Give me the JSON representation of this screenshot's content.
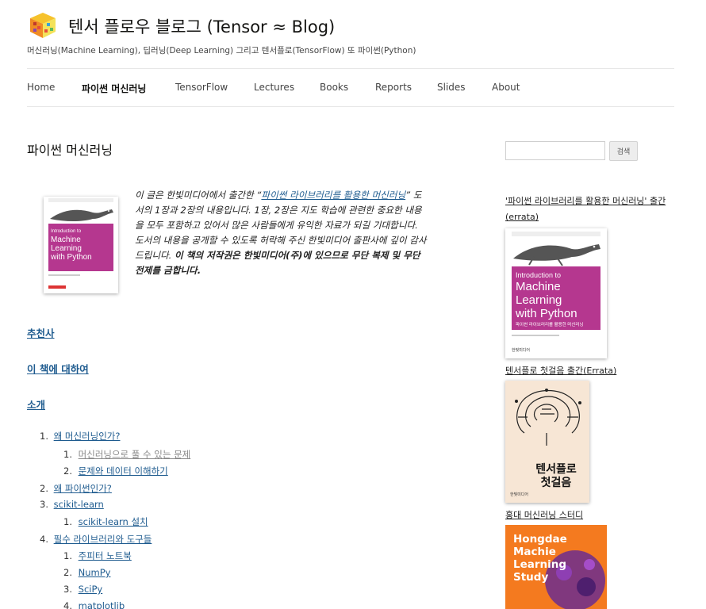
{
  "site": {
    "title": "텐서 플로우 블로그 (Tensor ≈ Blog)",
    "description": "머신러닝(Machine Learning), 딥러닝(Deep Learning) 그리고 텐서플로(TensorFlow) 또 파이썬(Python)"
  },
  "nav": [
    "Home",
    "파이썬 머신러닝",
    "TensorFlow",
    "Lectures",
    "Books",
    "Reports",
    "Slides",
    "About"
  ],
  "nav_current": "파이썬 머신러닝",
  "page": {
    "title": "파이썬 머신러닝",
    "intro_1": "이 글은 한빛미디어에서 출간한 “",
    "intro_link": "파이썬 라이브러리를 활용한 머신러닝",
    "intro_2": "” 도서의 1장과 2장의 내용입니다. 1장, 2장은 지도 학습에 관련한 중요한 내용을 모두 포함하고 있어서 많은 사람들에게 유익한 자료가 되길 기대합니다. 도서의 내용을 공개할 수 있도록 허락해 주신 한빛미디어 출판사에 깊이 감사드립니다. ",
    "intro_bold": "이 책의 저작권은 한빛미디어(주)에 있으므로 무단 복제 및 무단 전제를 금합니다."
  },
  "sections": [
    "추천사",
    "이 책에 대하여",
    "소개"
  ],
  "toc": [
    {
      "num": "1.",
      "label": "왜 머신러닝인가?",
      "children": [
        {
          "num": "1.",
          "label": "머신러닝으로 풀 수 있는 문제",
          "visited": true
        },
        {
          "num": "2.",
          "label": "문제와 데이터 이해하기"
        }
      ]
    },
    {
      "num": "2.",
      "label": "왜 파이썬인가?"
    },
    {
      "num": "3.",
      "label": "scikit-learn",
      "children": [
        {
          "num": "1.",
          "label": "scikit-learn 설치"
        }
      ]
    },
    {
      "num": "4.",
      "label": "필수 라이브러리와 도구들",
      "children": [
        {
          "num": "1.",
          "label": "주피터 노트북"
        },
        {
          "num": "2.",
          "label": "NumPy"
        },
        {
          "num": "3.",
          "label": "SciPy"
        },
        {
          "num": "4.",
          "label": "matplotlib"
        }
      ]
    }
  ],
  "sidebar": {
    "search_button": "검색",
    "widget1_title": "'파이썬 라이브러리를 활용한 머신러닝' 출간 (errata)",
    "widget2_title": "텐서플로 첫걸음 출간(Errata)",
    "widget3_title": "홍대 머신러닝 스터디"
  },
  "book_mlpy": {
    "line1": "Introduction to",
    "line2": "Machine",
    "line3": "Learning",
    "line4": "with Python",
    "subtitle": "파이썬 라이브러리를 활용한 머신러닝",
    "publisher": "한빛미디어"
  },
  "book_tf": {
    "title1": "텐서플로",
    "title2": "첫걸음",
    "publisher": "한빛미디어"
  },
  "study": {
    "line1": "Hongdae",
    "line2": "Machie",
    "line3": "Learning",
    "line4": "Study"
  },
  "colors": {
    "link": "#1e5b8f",
    "cover_magenta": "#b5378f",
    "study_orange": "#f47a1f"
  }
}
